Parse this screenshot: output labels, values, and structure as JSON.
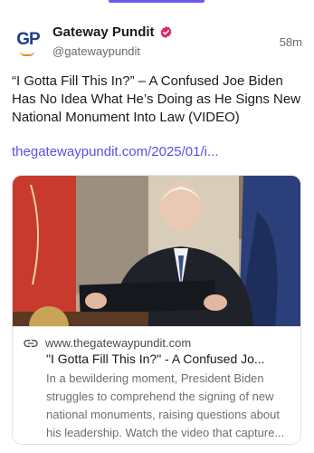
{
  "post": {
    "author": {
      "display_name": "Gateway Pundit",
      "handle": "@gatewaypundit",
      "avatar_text": "GP",
      "verified": true
    },
    "timestamp": "58m",
    "text": "“I Gotta Fill This In?” – A Confused Joe Biden Has No Idea What He’s Doing as He Signs New National Monument Into Law (VIDEO)",
    "link": "thegatewaypundit.com/2025/01/i..."
  },
  "card": {
    "domain": "www.thegatewaypundit.com",
    "title": "\"I Gotta Fill This In?\" - A Confused Jo...",
    "description": "In a bewildering moment, President Biden struggles to comprehend the signing of new national monuments, raising questions about his leadership. Watch the video that capture..."
  },
  "colors": {
    "accent": "#6b5cf0",
    "link": "#5a4ee6",
    "verified": "#e0245e",
    "brand_blue": "#1f3d8a",
    "brand_orange": "#f08a1c"
  },
  "icons": {
    "verified": "verified-badge-icon",
    "link": "link-icon"
  }
}
